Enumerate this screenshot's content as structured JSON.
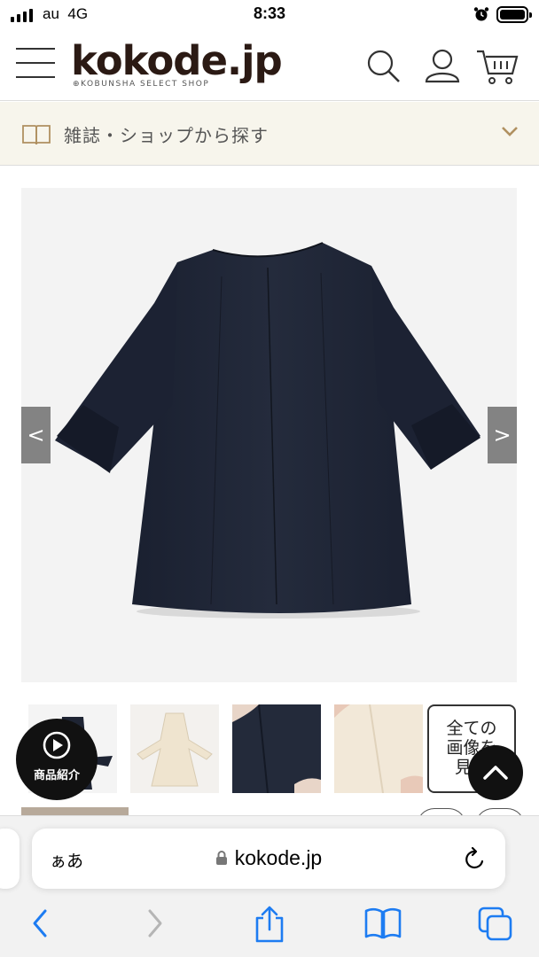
{
  "status_bar": {
    "carrier": "au",
    "network": "4G",
    "time": "8:33",
    "battery_level": 1.0
  },
  "header": {
    "logo_main": "koko",
    "logo_de": "de",
    "logo_jp": ".jp",
    "logo_sub": "⊕KOBUNSHA SELECT SHOP",
    "icons": [
      "menu-icon",
      "search-icon",
      "user-icon",
      "cart-icon"
    ]
  },
  "magazine_bar": {
    "label": "雑誌・ショップから探す",
    "icon": "book-icon"
  },
  "gallery": {
    "prev_label": "<",
    "next_label": ">",
    "all_images_label_1": "全ての",
    "all_images_label_2": "画像を",
    "all_images_label_3": "見る",
    "thumbnails": [
      "navy-coat-front",
      "ivory-coat-front",
      "navy-detail",
      "ivory-detail"
    ]
  },
  "floating": {
    "intro_label": "商品紹介",
    "top_icon": "chevron-up-icon"
  },
  "browser": {
    "aa_label": "ぁあ",
    "url": "kokode.jp"
  },
  "colors": {
    "navy": "#1e2433",
    "ivory": "#efe4cf",
    "accent_brown": "#b09060",
    "ios_blue": "#1d7cf2"
  }
}
